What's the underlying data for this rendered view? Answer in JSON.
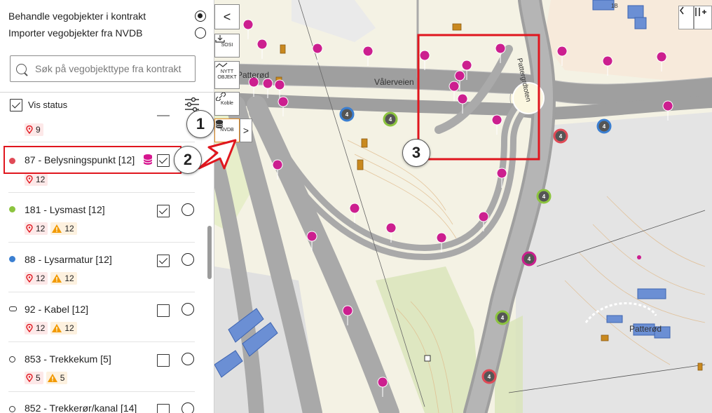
{
  "panel": {
    "mode_options": [
      {
        "label": "Behandle vegobjekter i kontrakt",
        "selected": true
      },
      {
        "label": "Importer vegobjekter fra NVDB",
        "selected": false
      }
    ],
    "search_placeholder": "Søk på vegobjekttype fra kontrakt",
    "vis_status_label": "Vis status",
    "vis_status_checked": true,
    "first_group_badge": "9",
    "objects": [
      {
        "label": "87 - Belysningspunkt [12]",
        "dot_color": "#e04a56",
        "marker": "dot",
        "checked": true,
        "has_db_icon": true,
        "issue_count": "12",
        "warn_count": ""
      },
      {
        "label": "181 - Lysmast [12]",
        "dot_color": "#8cc43f",
        "marker": "dot",
        "checked": true,
        "issue_count": "12",
        "warn_count": "12"
      },
      {
        "label": "88 - Lysarmatur [12]",
        "dot_color": "#3b7fd1",
        "marker": "dot",
        "checked": true,
        "issue_count": "12",
        "warn_count": "12"
      },
      {
        "label": "92 - Kabel [12]",
        "dot_color": "#ffffff",
        "marker": "pill",
        "checked": false,
        "issue_count": "12",
        "warn_count": "12"
      },
      {
        "label": "853 - Trekkekum [5]",
        "dot_color": "#ffffff",
        "marker": "ring",
        "checked": false,
        "issue_count": "5",
        "warn_count": "5"
      },
      {
        "label": "852 - Trekkerør/kanal [14]",
        "dot_color": "#ffffff",
        "marker": "ring",
        "checked": false,
        "issue_count": "",
        "warn_count": ""
      }
    ]
  },
  "map_tools": {
    "collapse_label": "<",
    "sosi_label": "SOSI",
    "new_object_label_1": "NYTT",
    "new_object_label_2": "OBJEKT",
    "link_label": "Koble",
    "nvdb_label": "NVDB",
    "expand_label": ">"
  },
  "map_labels": {
    "street": "Vålerveien",
    "place_1": "Patterød",
    "place_2": "Patterød",
    "road_vertical": "Pattergrdtoten",
    "building_number": "1B"
  },
  "callouts": [
    "1",
    "2",
    "3"
  ],
  "colors": {
    "highlight": "#e0161e",
    "pin": "#cc1f8f",
    "warning": "#f29a00",
    "issue_bg": "#fde8e8"
  }
}
